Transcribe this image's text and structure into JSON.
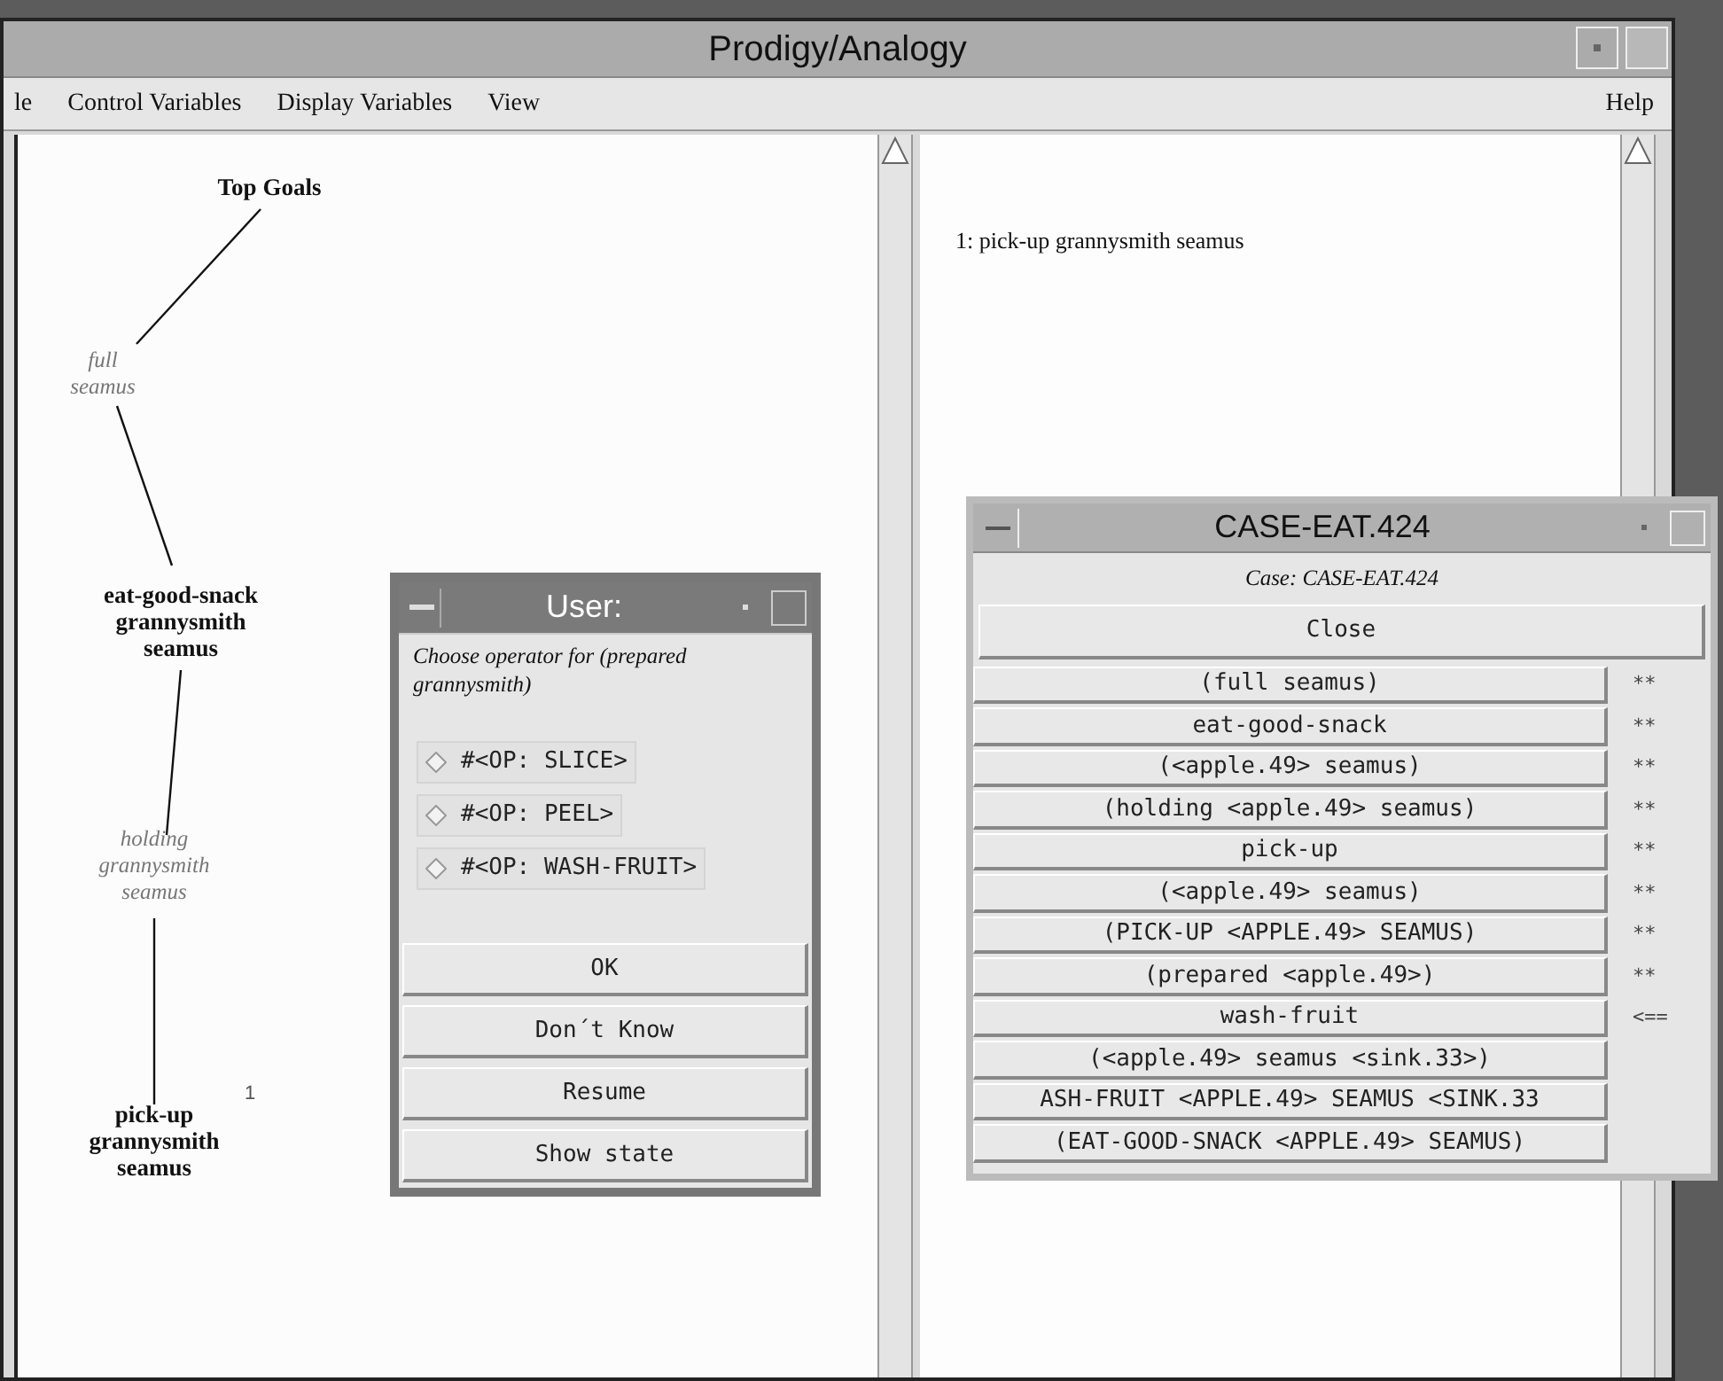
{
  "window": {
    "title": "Prodigy/Analogy"
  },
  "menu_bar": {
    "items": [
      {
        "label": "le"
      },
      {
        "label": "Control Variables"
      },
      {
        "label": "Display Variables"
      },
      {
        "label": "View"
      }
    ],
    "help": "Help"
  },
  "goal_tree": {
    "root": {
      "kind": "goal",
      "lines": [
        "Top Goals"
      ],
      "children": [
        {
          "kind": "state",
          "lines": [
            "full",
            "seamus"
          ],
          "children": [
            {
              "kind": "goal",
              "lines": [
                "eat-good-snack",
                "grannysmith",
                "seamus"
              ],
              "children": [
                {
                  "kind": "state",
                  "lines": [
                    "holding",
                    "grannysmith",
                    "seamus"
                  ],
                  "children": [
                    {
                      "kind": "goal",
                      "lines": [
                        "pick-up",
                        "grannysmith",
                        "seamus"
                      ],
                      "annotation": "1"
                    }
                  ]
                }
              ]
            }
          ]
        }
      ]
    }
  },
  "plan_pane": {
    "lines": [
      "1: pick-up grannysmith seamus"
    ]
  },
  "user_dialog": {
    "title": "User:",
    "prompt": "Choose operator for (prepared grannysmith)",
    "options": [
      {
        "label": "#<OP: SLICE>",
        "selected": false
      },
      {
        "label": "#<OP: PEEL>",
        "selected": false
      },
      {
        "label": "#<OP: WASH-FRUIT>",
        "selected": false
      }
    ],
    "buttons": [
      "OK",
      "Don´t Know",
      "Resume",
      "Show state"
    ]
  },
  "case_window": {
    "title": "CASE-EAT.424",
    "subtitle": "Case: CASE-EAT.424",
    "close_button": "Close",
    "rows": [
      {
        "label": "(full seamus)",
        "mark": "**"
      },
      {
        "label": "eat-good-snack",
        "mark": "**"
      },
      {
        "label": "(<apple.49> seamus)",
        "mark": "**"
      },
      {
        "label": "(holding <apple.49> seamus)",
        "mark": "**"
      },
      {
        "label": "pick-up",
        "mark": "**"
      },
      {
        "label": "(<apple.49> seamus)",
        "mark": "**"
      },
      {
        "label": "(PICK-UP <APPLE.49> SEAMUS)",
        "mark": "**"
      },
      {
        "label": "(prepared <apple.49>)",
        "mark": "**"
      },
      {
        "label": "wash-fruit",
        "mark": "<=="
      },
      {
        "label": "(<apple.49> seamus <sink.33>)"
      },
      {
        "label": "ASH-FRUIT <APPLE.49> SEAMUS <SINK.33"
      },
      {
        "label": "(EAT-GOOD-SNACK <APPLE.49> SEAMUS)"
      }
    ]
  }
}
